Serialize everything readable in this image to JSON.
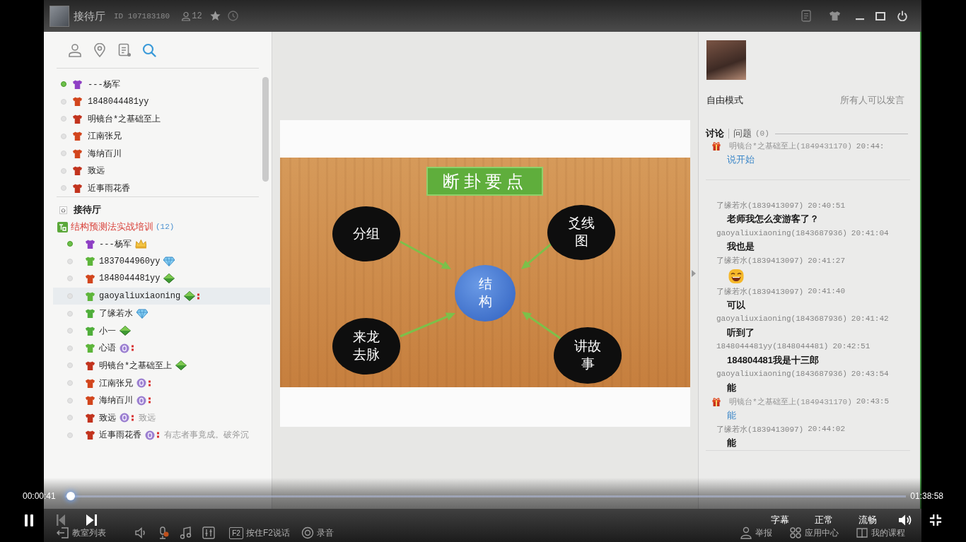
{
  "window": {
    "title": "接待厅",
    "room_id": "ID 107183180",
    "member_count": "12"
  },
  "sidebar": {
    "tools": [
      {
        "kind": "people",
        "selected": false
      },
      {
        "kind": "location",
        "selected": false
      },
      {
        "kind": "notes",
        "selected": false
      },
      {
        "kind": "search",
        "selected": true
      }
    ],
    "user_list": [
      {
        "name": "---杨军",
        "online": true,
        "color": "#8e3fc4"
      },
      {
        "name": "1848044481yy",
        "online": false,
        "color": "#d2451c"
      },
      {
        "name": "明镜台*之基础至上",
        "online": false,
        "color": "#c2331d"
      },
      {
        "name": "江南张兄",
        "online": false,
        "color": "#d2451c"
      },
      {
        "name": "海纳百川",
        "online": false,
        "color": "#d2451c"
      },
      {
        "name": "致远",
        "online": false,
        "color": "#c2331d"
      },
      {
        "name": "近事雨花香",
        "online": false,
        "color": "#c2331d"
      }
    ],
    "hall": "接待厅",
    "group": {
      "name": "结构预测法实战培训",
      "count": "(12)"
    },
    "members": [
      {
        "name": "---杨军",
        "online": true,
        "color": "#8e3fc4",
        "badge": {
          "kind": "crown"
        },
        "indicator": false,
        "selected": false
      },
      {
        "name": "1837044960yy",
        "online": false,
        "color": "#5db53a",
        "badge": {
          "kind": "diamond"
        },
        "indicator": false,
        "selected": false
      },
      {
        "name": "1848044481yy",
        "online": false,
        "color": "#d2451c",
        "badge": {
          "kind": "gem"
        },
        "indicator": false,
        "selected": false
      },
      {
        "name": "gaoyaliuxiaoning",
        "online": false,
        "color": "#5db53a",
        "badge": {
          "kind": "gem"
        },
        "indicator": true,
        "selected": true
      },
      {
        "name": "了缘若水",
        "online": false,
        "color": "#4fae3a",
        "badge": {
          "kind": "diamond"
        },
        "indicator": false,
        "selected": false
      },
      {
        "name": "小一",
        "online": false,
        "color": "#4fae3a",
        "badge": {
          "kind": "gem"
        },
        "indicator": false,
        "selected": false
      },
      {
        "name": "心语",
        "online": false,
        "color": "#5db53a",
        "badge": {
          "kind": "token"
        },
        "indicator": true,
        "selected": false
      },
      {
        "name": "明镜台*之基础至上",
        "online": false,
        "color": "#c2331d",
        "badge": {
          "kind": "gem"
        },
        "indicator": false,
        "selected": false
      },
      {
        "name": "江南张兄",
        "online": false,
        "color": "#d2451c",
        "badge": {
          "kind": "token"
        },
        "indicator": true,
        "selected": false
      },
      {
        "name": "海纳百川",
        "online": false,
        "color": "#d2451c",
        "badge": {
          "kind": "token"
        },
        "indicator": true,
        "selected": false
      },
      {
        "name": "致远",
        "online": false,
        "color": "#c2331d",
        "badge": {
          "kind": "token"
        },
        "indicator": true,
        "status": "致远",
        "selected": false
      },
      {
        "name": "近事雨花香",
        "online": false,
        "color": "#c2331d",
        "badge": {
          "kind": "token"
        },
        "indicator": true,
        "status": "有志者事竟成。破斧沉",
        "selected": false
      }
    ]
  },
  "slide": {
    "title": "断卦要点",
    "center": "结构",
    "nodes": [
      {
        "label": "分组"
      },
      {
        "label": "爻线图"
      },
      {
        "label": "来龙去脉"
      },
      {
        "label": "讲故事"
      }
    ]
  },
  "room_panel": {
    "mode": "自由模式",
    "permission": "所有人可以发言",
    "tabs": [
      {
        "label": "讨论",
        "selected": true
      },
      {
        "label": "问题",
        "selected": false,
        "count": "(0)"
      }
    ],
    "pinned": [
      {
        "author": "明镜台*之基础至上(1849431170)",
        "time": "20:44:",
        "vip": true,
        "kind": "text",
        "text": "说开始"
      }
    ],
    "messages": [
      {
        "author": "了缘若水(1839413097)",
        "time": "20:40:51",
        "vip": false,
        "kind": "text",
        "text": "老师我怎么变游客了？"
      },
      {
        "author": "gaoyaliuxiaoning(1843687936)",
        "time": "20:41:04",
        "vip": false,
        "kind": "text",
        "text": "我也是"
      },
      {
        "author": "了缘若水(1839413097)",
        "time": "20:41:27",
        "vip": false,
        "kind": "emoji"
      },
      {
        "author": "了缘若水(1839413097)",
        "time": "20:41:40",
        "vip": false,
        "kind": "text",
        "text": "可以"
      },
      {
        "author": "gaoyaliuxiaoning(1843687936)",
        "time": "20:41:42",
        "vip": false,
        "kind": "text",
        "text": "听到了"
      },
      {
        "author": "1848044481yy(1848044481)",
        "time": "20:42:51",
        "vip": false,
        "kind": "text",
        "text": "184804481我是十三郎"
      },
      {
        "author": "gaoyaliuxiaoning(1843687936)",
        "time": "20:43:54",
        "vip": false,
        "kind": "text",
        "text": "能"
      },
      {
        "author": "明镜台*之基础至上(1849431170)",
        "time": "20:43:5",
        "vip": true,
        "kind": "text",
        "text": "能"
      },
      {
        "author": "了缘若水(1839413097)",
        "time": "20:44:02",
        "vip": false,
        "kind": "text",
        "text": "能"
      }
    ]
  },
  "toolbar": {
    "left": [
      {
        "kind": "classroom",
        "label": "教室列表"
      },
      {
        "kind": "speaker"
      },
      {
        "kind": "mic"
      },
      {
        "kind": "music"
      },
      {
        "kind": "mixer"
      },
      {
        "kind": "talk",
        "key": "F2",
        "label": "按住F2说话"
      },
      {
        "kind": "record",
        "label": "录音"
      }
    ],
    "right": [
      {
        "kind": "report",
        "label": "举报"
      },
      {
        "kind": "apps",
        "label": "应用中心"
      },
      {
        "kind": "courses",
        "label": "我的课程"
      }
    ]
  },
  "player": {
    "playing": true,
    "previous_disabled": true,
    "elapsed": "00:00:41",
    "duration": "01:38:58",
    "progress": {
      "level": 0.007
    },
    "options": [
      "字幕",
      "正常",
      "流畅"
    ]
  }
}
